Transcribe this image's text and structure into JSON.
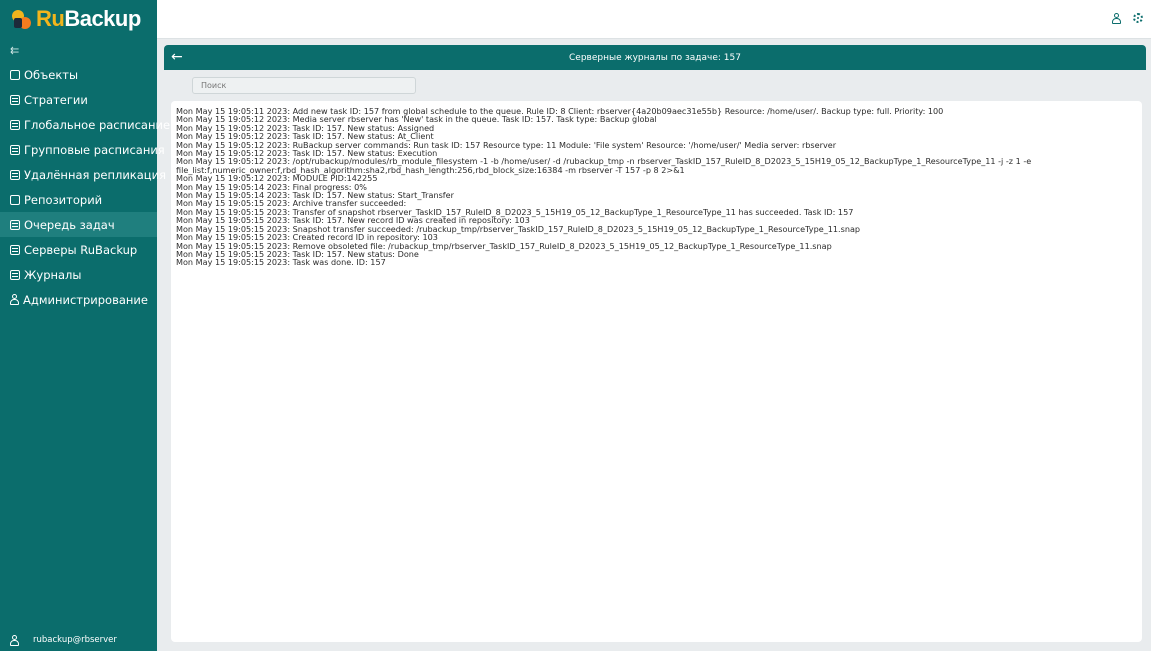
{
  "app": {
    "logo_ru": "Ru",
    "logo_backup": "Backup"
  },
  "sidebar": {
    "items": [
      {
        "label": "Объекты"
      },
      {
        "label": "Стратегии"
      },
      {
        "label": "Глобальное расписание"
      },
      {
        "label": "Групповые расписания"
      },
      {
        "label": "Удалённая репликация"
      },
      {
        "label": "Репозиторий"
      },
      {
        "label": "Очередь задач",
        "active": true
      },
      {
        "label": "Серверы RuBackup"
      },
      {
        "label": "Журналы"
      },
      {
        "label": "Администрирование"
      }
    ],
    "user": "rubackup@rbserver"
  },
  "header": {
    "title": "Серверные журналы по задаче: 157"
  },
  "search": {
    "placeholder": "Поиск"
  },
  "log": {
    "lines": [
      "Mon May 15 19:05:11 2023: Add new task ID: 157 from global schedule to the queue. Rule ID: 8 Client: rbserver{4a20b09aec31e55b} Resource: /home/user/. Backup type: full. Priority: 100",
      "Mon May 15 19:05:12 2023: Media server rbserver has 'New' task in the queue. Task ID: 157. Task type: Backup global",
      "Mon May 15 19:05:12 2023: Task ID: 157. New status: Assigned",
      "Mon May 15 19:05:12 2023: Task ID: 157. New status: At_Client",
      "Mon May 15 19:05:12 2023: RuBackup server commands: Run task ID: 157 Resource type: 11 Module: 'File system' Resource: '/home/user/' Media server: rbserver",
      "Mon May 15 19:05:12 2023: Task ID: 157. New status: Execution",
      "Mon May 15 19:05:12 2023: /opt/rubackup/modules/rb_module_filesystem -1 -b /home/user/ -d /rubackup_tmp -n rbserver_TaskID_157_RuleID_8_D2023_5_15H19_05_12_BackupType_1_ResourceType_11 -j -z 1 -e file_list:f,numeric_owner:f,rbd_hash_algorithm:sha2,rbd_hash_length:256,rbd_block_size:16384 -m rbserver -T 157 -p 8 2>&1",
      "Mon May 15 19:05:12 2023: MODULE PID:142255",
      "Mon May 15 19:05:14 2023: Final progress: 0%",
      "Mon May 15 19:05:14 2023: Task ID: 157. New status: Start_Transfer",
      "Mon May 15 19:05:15 2023: Archive transfer succeeded:",
      "Mon May 15 19:05:15 2023: Transfer of snapshot rbserver_TaskID_157_RuleID_8_D2023_5_15H19_05_12_BackupType_1_ResourceType_11 has succeeded. Task ID: 157",
      "Mon May 15 19:05:15 2023: Task ID: 157. New record ID was created in repository: 103",
      "Mon May 15 19:05:15 2023: Snapshot transfer succeeded: /rubackup_tmp/rbserver_TaskID_157_RuleID_8_D2023_5_15H19_05_12_BackupType_1_ResourceType_11.snap",
      "Mon May 15 19:05:15 2023: Created record ID in repository: 103",
      "Mon May 15 19:05:15 2023: Remove obsoleted file: /rubackup_tmp/rbserver_TaskID_157_RuleID_8_D2023_5_15H19_05_12_BackupType_1_ResourceType_11.snap",
      "Mon May 15 19:05:15 2023: Task ID: 157. New status: Done",
      "Mon May 15 19:05:15 2023: Task was done. ID: 157"
    ]
  },
  "colors": {
    "brand": "#0b6d6c",
    "logo_accent": "#f2b51c",
    "background": "#e9ecee"
  }
}
